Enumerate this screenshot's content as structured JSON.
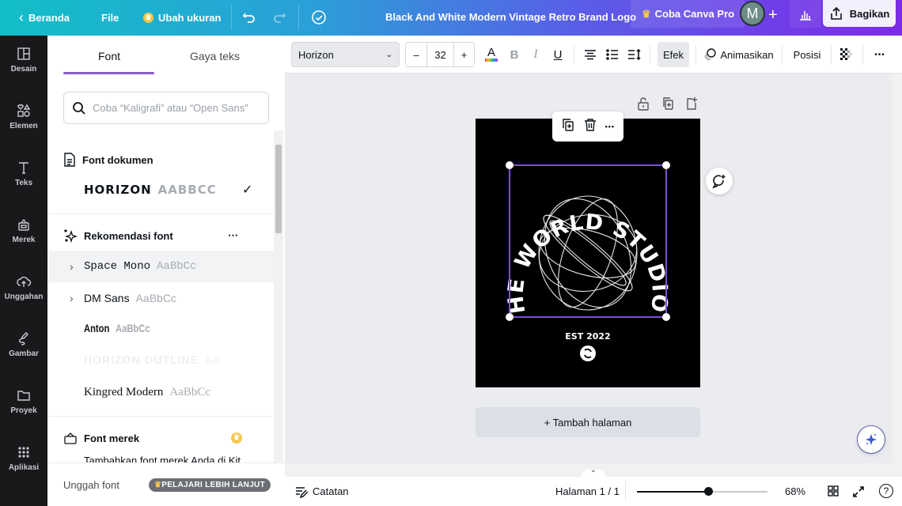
{
  "topbar": {
    "back_label": "Beranda",
    "file_label": "File",
    "resize_label": "Ubah ukuran",
    "doc_title": "Black And White Modern Vintage Retro Brand Logo",
    "pro_label": "Coba Canva Pro",
    "avatar_initial": "M",
    "share_label": "Bagikan"
  },
  "sidebar": {
    "items": [
      {
        "label": "Desain",
        "icon": "layout-icon"
      },
      {
        "label": "Elemen",
        "icon": "shapes-icon"
      },
      {
        "label": "Teks",
        "icon": "text-icon"
      },
      {
        "label": "Merek",
        "icon": "brand-icon"
      },
      {
        "label": "Unggahan",
        "icon": "upload-cloud-icon"
      },
      {
        "label": "Gambar",
        "icon": "draw-icon"
      },
      {
        "label": "Proyek",
        "icon": "folder-icon"
      },
      {
        "label": "Aplikasi",
        "icon": "apps-grid-icon"
      }
    ]
  },
  "font_panel": {
    "tabs": [
      {
        "label": "Font",
        "active": true
      },
      {
        "label": "Gaya teks",
        "active": false
      }
    ],
    "search_placeholder": "Coba “Kaligrafi” atau “Open Sans”",
    "document_fonts": {
      "heading": "Font dokumen",
      "items": [
        {
          "name": "HORIZON",
          "sample": "AABBCC",
          "selected": true
        }
      ]
    },
    "recommended": {
      "heading": "Rekomendasi font",
      "more": "⋯",
      "items": [
        {
          "name": "Space  Mono",
          "sample": "AaBbCc",
          "expandable": true
        },
        {
          "name": "DM Sans",
          "sample": "AaBbCc",
          "expandable": true
        },
        {
          "name": "Anton",
          "sample": "AaBbCc",
          "expandable": false
        },
        {
          "name": "HORIZON OUTLINE",
          "sample": "AA",
          "expandable": false
        },
        {
          "name": "Kingred Modern",
          "sample": "AaBbCc",
          "expandable": false
        }
      ]
    },
    "brand_fonts": {
      "heading": "Font merek",
      "description": "Tambahkan font merek Anda di Kit"
    },
    "footer": {
      "upload_label": "Unggah font",
      "learn_more": "PELAJARI LEBIH LANJUT"
    }
  },
  "toolbar": {
    "font_family": "Horizon",
    "font_size": "32",
    "minus": "–",
    "plus": "+",
    "effects_label": "Efek",
    "animate_label": "Animasikan",
    "position_label": "Posisi",
    "more": "•••"
  },
  "canvas": {
    "logo_top_text": "THE WORLD STUDIOS",
    "logo_est": "EST 2022",
    "add_page_label": "+ Tambah halaman",
    "float_more": "•••",
    "selection_color": "#7b4fd6"
  },
  "bottombar": {
    "notes_label": "Catatan",
    "page_label": "Halaman 1 / 1",
    "zoom_value": 68,
    "zoom_label": "68%",
    "help": "?"
  }
}
